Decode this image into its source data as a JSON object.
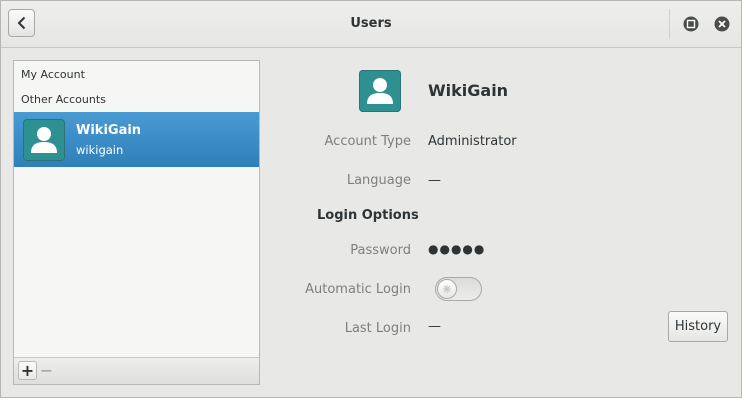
{
  "window": {
    "title": "Users"
  },
  "sidebar": {
    "my_account_label": "My Account",
    "other_accounts_label": "Other Accounts",
    "accounts": [
      {
        "name": "WikiGain",
        "username": "wikigain"
      }
    ],
    "add_label": "+",
    "remove_label": "−"
  },
  "main": {
    "name": "WikiGain",
    "account_type_label": "Account Type",
    "account_type_value": "Administrator",
    "language_label": "Language",
    "language_value": "—",
    "login_options_label": "Login Options",
    "password_label": "Password",
    "password_value": "●●●●●",
    "automatic_login_label": "Automatic Login",
    "automatic_login_on": false,
    "last_login_label": "Last Login",
    "last_login_value": "—",
    "history_button": "History"
  },
  "colors": {
    "selection": "#3d8ec6",
    "avatar_bg": "#2f9092"
  }
}
